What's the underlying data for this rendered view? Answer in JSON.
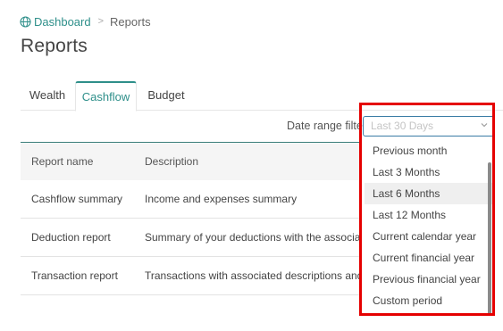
{
  "breadcrumb": {
    "icon": "globe-icon",
    "home_label": "Dashboard",
    "separator": ">",
    "current_label": "Reports"
  },
  "page": {
    "title": "Reports"
  },
  "tabs": [
    {
      "label": "Wealth",
      "active": false
    },
    {
      "label": "Cashflow",
      "active": true
    },
    {
      "label": "Budget",
      "active": false
    }
  ],
  "filter": {
    "label": "Date range filter",
    "placeholder": "Last 30 Days",
    "chevron_icon": "chevron-down-icon"
  },
  "table": {
    "columns": [
      "Report name",
      "Description"
    ],
    "rows": [
      {
        "name": "Cashflow summary",
        "description": "Income and expenses summary"
      },
      {
        "name": "Deduction report",
        "description": "Summary of your deductions with the associated re"
      },
      {
        "name": "Transaction report",
        "description": "Transactions with associated descriptions and tags"
      }
    ]
  },
  "dropdown": {
    "options": [
      "Previous month",
      "Last 3 Months",
      "Last 6 Months",
      "Last 12 Months",
      "Current calendar year",
      "Current financial year",
      "Previous financial year",
      "Custom period"
    ],
    "hovered": "Last 6 Months"
  },
  "colors": {
    "accent": "#2e8f8a",
    "select_border": "#3a7ca5",
    "highlight": "#e50000"
  }
}
